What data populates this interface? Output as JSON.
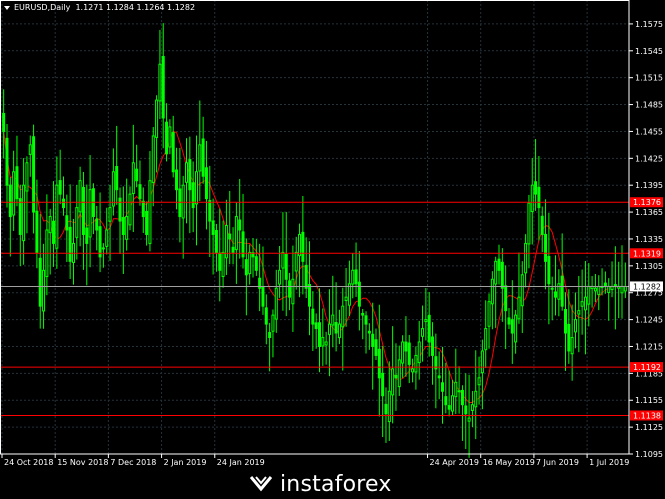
{
  "header": {
    "symbol_timeframe": "EURUSD,Daily",
    "ohlc": "1.1271 1.1284 1.1264 1.1282"
  },
  "watermark": {
    "text": "instaforex"
  },
  "colors": {
    "background": "#000000",
    "grid": "#24323a",
    "frame": "#ffffff",
    "bull_candle": "#00ff00",
    "bear_candle": "#00ff00",
    "moving_average": "#ff0000",
    "level_line": "#ff0000",
    "text": "#ffffff",
    "level_label_bg": "#ff0000"
  },
  "chart_data": {
    "type": "candlestick",
    "symbol": "EURUSD",
    "timeframe": "Daily",
    "y_range": [
      1.1095,
      1.1595
    ],
    "y_ticks": [
      "1.1575",
      "1.1545",
      "1.1515",
      "1.1485",
      "1.1455",
      "1.1425",
      "1.1395",
      "1.1365",
      "1.1335",
      "1.1305",
      "1.1275",
      "1.1245",
      "1.1215",
      "1.1185",
      "1.1155",
      "1.1125",
      "1.1095"
    ],
    "x_labels": [
      "24 Oct 2018",
      "15 Nov 2018",
      "7 Dec 2018",
      "2 Jan 2019",
      "24 Jan 2019",
      "24 Apr 2019",
      "16 May 2019",
      "7 Jun 2019",
      "1 Jul 2019"
    ],
    "x_label_bar_index": [
      0,
      16,
      32,
      48,
      64,
      128,
      144,
      160,
      176
    ],
    "bar_count": 188,
    "horizontal_levels": [
      {
        "label": "1.1376",
        "value": 1.1376
      },
      {
        "label": "1.1319",
        "value": 1.1319
      },
      {
        "label": "1.1192",
        "value": 1.1192
      },
      {
        "label": "1.1138",
        "value": 1.1138
      }
    ],
    "current_price": {
      "label": "1.1282",
      "value": 1.1282
    },
    "price_path": [
      1.1455,
      1.1395,
      1.136,
      1.141,
      1.138,
      1.134,
      1.1395,
      1.142,
      1.144,
      1.1365,
      1.132,
      1.126,
      1.13,
      1.1345,
      1.136,
      1.133,
      1.1395,
      1.1385,
      1.137,
      1.1345,
      1.131,
      1.133,
      1.137,
      1.14,
      1.134,
      1.133,
      1.139,
      1.136,
      1.1345,
      1.1315,
      1.1325,
      1.1345,
      1.137,
      1.141,
      1.139,
      1.1355,
      1.134,
      1.136,
      1.1385,
      1.142,
      1.14,
      1.138,
      1.136,
      1.134,
      1.14,
      1.145,
      1.149,
      1.153,
      1.147,
      1.143,
      1.146,
      1.141,
      1.139,
      1.136,
      1.1395,
      1.142,
      1.139,
      1.137,
      1.141,
      1.144,
      1.1405,
      1.138,
      1.1355,
      1.134,
      1.132,
      1.13,
      1.132,
      1.135,
      1.1335,
      1.132,
      1.136,
      1.1345,
      1.1315,
      1.1295,
      1.132,
      1.1315,
      1.13,
      1.128,
      1.126,
      1.124,
      1.1225,
      1.125,
      1.128,
      1.13,
      1.132,
      1.129,
      1.127,
      1.129,
      1.132,
      1.134,
      1.131,
      1.128,
      1.126,
      1.124,
      1.1235,
      1.1215,
      1.1225,
      1.122,
      1.124,
      1.125,
      1.123,
      1.124,
      1.126,
      1.127,
      1.1285,
      1.13,
      1.1285,
      1.126,
      1.125,
      1.124,
      1.123,
      1.1215,
      1.1205,
      1.118,
      1.116,
      1.114,
      1.1165,
      1.119,
      1.118,
      1.12,
      1.122,
      1.121,
      1.1195,
      1.119,
      1.1205,
      1.122,
      1.1235,
      1.1245,
      1.122,
      1.1205,
      1.119,
      1.118,
      1.1165,
      1.115,
      1.1145,
      1.116,
      1.1175,
      1.1165,
      1.115,
      1.114,
      1.1135,
      1.115,
      1.1165,
      1.118,
      1.121,
      1.1235,
      1.1265,
      1.129,
      1.131,
      1.13,
      1.128,
      1.1255,
      1.124,
      1.123,
      1.125,
      1.127,
      1.1295,
      1.133,
      1.1375,
      1.1395,
      1.1385,
      1.137,
      1.134,
      1.131,
      1.1285,
      1.128,
      1.127,
      1.1285,
      1.126,
      1.123,
      1.121,
      1.1225,
      1.1245,
      1.1255,
      1.1265,
      1.127,
      1.1282,
      1.1282,
      1.128,
      1.1282,
      1.1282,
      1.1282,
      1.1282,
      1.1282
    ]
  }
}
